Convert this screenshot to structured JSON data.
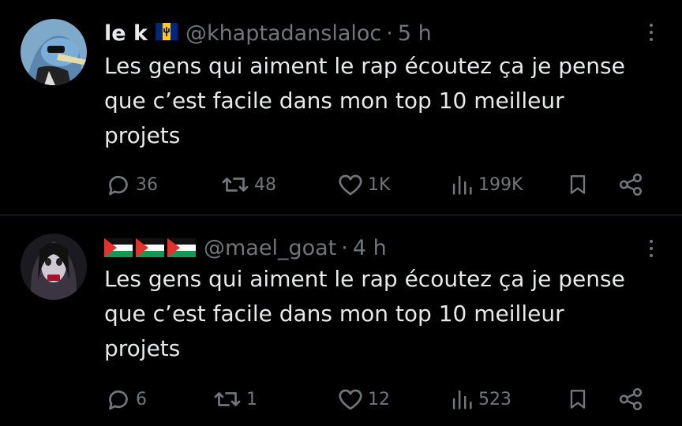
{
  "tweets": [
    {
      "display_name": "le k",
      "flag_icon": "barbados-flag-icon",
      "handle": "@khaptadanslaloc",
      "separator": "·",
      "time": "5 h",
      "text_lines": [
        "Les gens qui aiment le rap écoutez ça je pense",
        "que c’est facile dans mon top 10 meilleur",
        "projets"
      ],
      "replies": "36",
      "retweets": "48",
      "likes": "1K",
      "views": "199K"
    },
    {
      "display_name": "",
      "flag_icon": "palestine-flag-icon",
      "flag_count": 3,
      "handle": "@mael_goat",
      "separator": "·",
      "time": "4 h",
      "text_lines": [
        "Les gens qui aiment le rap écoutez ça je pense",
        "que c’est facile dans mon top 10 meilleur",
        "projets"
      ],
      "replies": "6",
      "retweets": "1",
      "likes": "12",
      "views": "523"
    }
  ],
  "colors": {
    "background": "#000000",
    "text": "#e7e9ea",
    "secondary": "#71767b",
    "divider": "#2f3336"
  }
}
